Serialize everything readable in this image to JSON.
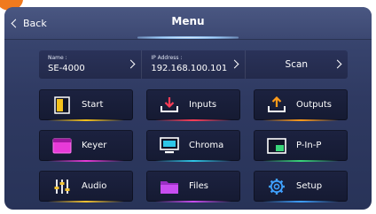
{
  "header": {
    "back_label": "Back",
    "title": "Menu"
  },
  "info": {
    "name": {
      "label": "Name :",
      "value": "SE-4000"
    },
    "ip": {
      "label": "IP Address :",
      "value": "192.168.100.101"
    },
    "scan": {
      "label": "Scan"
    }
  },
  "buttons": {
    "start": {
      "label": "Start",
      "icon": "start-panel-icon",
      "color": "#f5c21b"
    },
    "inputs": {
      "label": "Inputs",
      "icon": "download-icon",
      "color": "#ff3d57"
    },
    "outputs": {
      "label": "Outputs",
      "icon": "upload-icon",
      "color": "#ff9b1a"
    },
    "keyer": {
      "label": "Keyer",
      "icon": "keyer-window-icon",
      "color": "#e83ad8"
    },
    "chroma": {
      "label": "Chroma",
      "icon": "monitor-icon",
      "color": "#2ec7e8"
    },
    "pinp": {
      "label": "P-In-P",
      "icon": "picture-in-picture-icon",
      "color": "#39d67a"
    },
    "audio": {
      "label": "Audio",
      "icon": "audio-sliders-icon",
      "color": "#f2c232"
    },
    "files": {
      "label": "Files",
      "icon": "folder-icon",
      "color": "#c84df0"
    },
    "setup": {
      "label": "Setup",
      "icon": "gear-icon",
      "color": "#3fa0ff"
    }
  }
}
